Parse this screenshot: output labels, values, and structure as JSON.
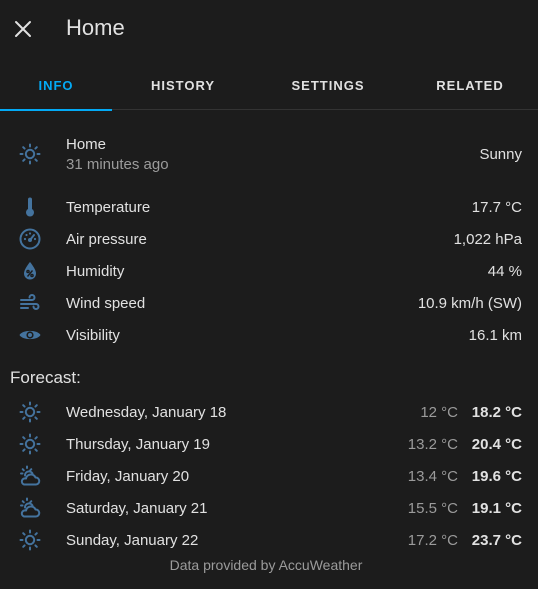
{
  "header": {
    "title": "Home",
    "close_icon": "close-icon"
  },
  "tabs": [
    {
      "label": "INFO",
      "active": true
    },
    {
      "label": "HISTORY",
      "active": false
    },
    {
      "label": "SETTINGS",
      "active": false
    },
    {
      "label": "RELATED",
      "active": false
    }
  ],
  "current": {
    "name": "Home",
    "time": "31 minutes ago",
    "state": "Sunny",
    "icon": "sunny-icon"
  },
  "attributes": [
    {
      "label": "Temperature",
      "value": "17.7 °C",
      "icon": "thermometer-icon"
    },
    {
      "label": "Air pressure",
      "value": "1,022 hPa",
      "icon": "gauge-icon"
    },
    {
      "label": "Humidity",
      "value": "44 %",
      "icon": "water-percent-icon"
    },
    {
      "label": "Wind speed",
      "value": "10.9 km/h (SW)",
      "icon": "wind-icon"
    },
    {
      "label": "Visibility",
      "value": "16.1 km",
      "icon": "eye-icon"
    }
  ],
  "forecast": {
    "title": "Forecast:",
    "days": [
      {
        "day": "Wednesday, January 18",
        "low": "12 °C",
        "high": "18.2 °C",
        "icon": "sunny-icon"
      },
      {
        "day": "Thursday, January 19",
        "low": "13.2 °C",
        "high": "20.4 °C",
        "icon": "sunny-icon"
      },
      {
        "day": "Friday, January 20",
        "low": "13.4 °C",
        "high": "19.6 °C",
        "icon": "partly-cloudy-icon"
      },
      {
        "day": "Saturday, January 21",
        "low": "15.5 °C",
        "high": "19.1 °C",
        "icon": "partly-cloudy-icon"
      },
      {
        "day": "Sunday, January 22",
        "low": "17.2 °C",
        "high": "23.7 °C",
        "icon": "sunny-icon"
      }
    ]
  },
  "attribution": "Data provided by AccuWeather",
  "colors": {
    "accent": "#03a9f4",
    "icon": "#44739e",
    "background": "#1c1c1c"
  }
}
